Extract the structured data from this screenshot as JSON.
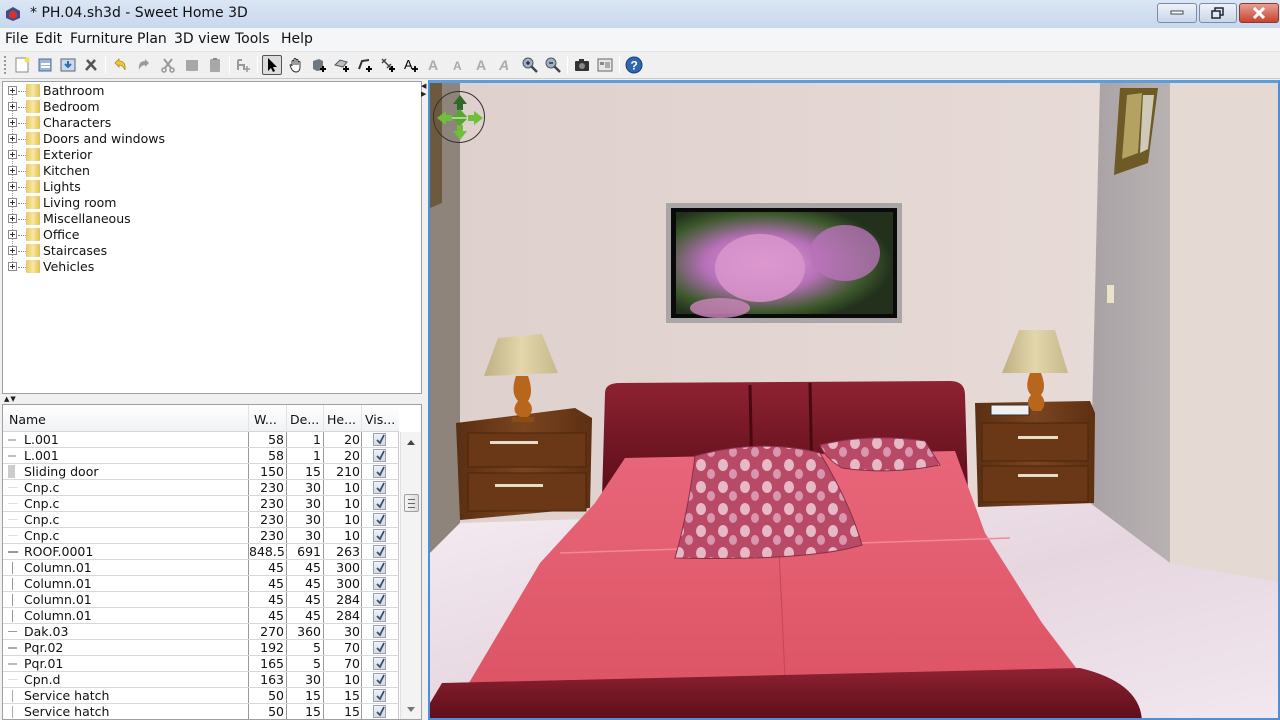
{
  "window": {
    "title": "* PH.04.sh3d - Sweet Home 3D",
    "controls": {
      "minimize": "minimize-icon",
      "maximize": "restore-icon",
      "close": "close-icon"
    }
  },
  "menu": {
    "items": [
      "File",
      "Edit",
      "Furniture",
      "Plan",
      "3D view",
      "Tools",
      "Help"
    ]
  },
  "toolbar": {
    "buttons": [
      {
        "name": "new-home",
        "icon": "new-file-icon",
        "enabled": true
      },
      {
        "name": "open",
        "icon": "open-folder-icon",
        "enabled": true
      },
      {
        "name": "save",
        "icon": "save-icon",
        "enabled": true
      },
      {
        "name": "preferences",
        "icon": "tools-icon",
        "enabled": true
      },
      {
        "name": "undo",
        "icon": "undo-icon",
        "enabled": true
      },
      {
        "name": "redo",
        "icon": "redo-icon",
        "enabled": false
      },
      {
        "name": "cut",
        "icon": "cut-icon",
        "enabled": false
      },
      {
        "name": "copy",
        "icon": "copy-icon",
        "enabled": false
      },
      {
        "name": "paste",
        "icon": "paste-icon",
        "enabled": false
      },
      {
        "name": "add-furniture",
        "icon": "add-furniture-icon",
        "enabled": false
      },
      {
        "name": "select-mode",
        "icon": "arrow-cursor-icon",
        "enabled": true,
        "selected": true
      },
      {
        "name": "pan-mode",
        "icon": "hand-icon",
        "enabled": true
      },
      {
        "name": "create-walls",
        "icon": "create-walls-icon",
        "enabled": true
      },
      {
        "name": "create-rooms",
        "icon": "create-rooms-icon",
        "enabled": true
      },
      {
        "name": "create-polylines",
        "icon": "create-polylines-icon",
        "enabled": true
      },
      {
        "name": "create-dimensions",
        "icon": "create-dimensions-icon",
        "enabled": true
      },
      {
        "name": "add-text",
        "icon": "add-text-icon",
        "enabled": true
      },
      {
        "name": "increase-text-size",
        "icon": "increase-text-icon",
        "enabled": false
      },
      {
        "name": "decrease-text-size",
        "icon": "decrease-text-icon",
        "enabled": false
      },
      {
        "name": "bold-text",
        "icon": "bold-text-icon",
        "enabled": false
      },
      {
        "name": "italic-text",
        "icon": "italic-text-icon",
        "enabled": false
      },
      {
        "name": "zoom-in",
        "icon": "zoom-in-icon",
        "enabled": true
      },
      {
        "name": "zoom-out",
        "icon": "zoom-out-icon",
        "enabled": true
      },
      {
        "name": "create-photo",
        "icon": "camera-icon",
        "enabled": true
      },
      {
        "name": "create-video",
        "icon": "video-icon",
        "enabled": true
      },
      {
        "name": "help",
        "icon": "help-icon",
        "enabled": true
      }
    ]
  },
  "catalog": {
    "categories": [
      "Bathroom",
      "Bedroom",
      "Characters",
      "Doors and windows",
      "Exterior",
      "Kitchen",
      "Lights",
      "Living room",
      "Miscellaneous",
      "Office",
      "Staircases",
      "Vehicles"
    ]
  },
  "furniture_table": {
    "columns": [
      "Name",
      "W...",
      "De...",
      "He...",
      "Vis..."
    ],
    "rows": [
      {
        "name": "L.001",
        "width": "58",
        "depth": "1",
        "height": "20",
        "visible": true
      },
      {
        "name": "L.001",
        "width": "58",
        "depth": "1",
        "height": "20",
        "visible": true
      },
      {
        "name": "Sliding door",
        "width": "150",
        "depth": "15",
        "height": "210",
        "visible": true
      },
      {
        "name": "Cnp.c",
        "width": "230",
        "depth": "30",
        "height": "10",
        "visible": true
      },
      {
        "name": "Cnp.c",
        "width": "230",
        "depth": "30",
        "height": "10",
        "visible": true
      },
      {
        "name": "Cnp.c",
        "width": "230",
        "depth": "30",
        "height": "10",
        "visible": true
      },
      {
        "name": "Cnp.c",
        "width": "230",
        "depth": "30",
        "height": "10",
        "visible": true
      },
      {
        "name": "ROOF.0001",
        "width": "848.5",
        "depth": "691",
        "height": "263",
        "visible": true
      },
      {
        "name": "Column.01",
        "width": "45",
        "depth": "45",
        "height": "300",
        "visible": true
      },
      {
        "name": "Column.01",
        "width": "45",
        "depth": "45",
        "height": "300",
        "visible": true
      },
      {
        "name": "Column.01",
        "width": "45",
        "depth": "45",
        "height": "284",
        "visible": true
      },
      {
        "name": "Column.01",
        "width": "45",
        "depth": "45",
        "height": "284",
        "visible": true
      },
      {
        "name": "Dak.03",
        "width": "270",
        "depth": "360",
        "height": "30",
        "visible": true
      },
      {
        "name": "Pqr.02",
        "width": "192",
        "depth": "5",
        "height": "70",
        "visible": true
      },
      {
        "name": "Pqr.01",
        "width": "165",
        "depth": "5",
        "height": "70",
        "visible": true
      },
      {
        "name": "Cpn.d",
        "width": "163",
        "depth": "30",
        "height": "10",
        "visible": true
      },
      {
        "name": "Service hatch",
        "width": "50",
        "depth": "15",
        "height": "15",
        "visible": true
      },
      {
        "name": "Service hatch",
        "width": "50",
        "depth": "15",
        "height": "15",
        "visible": true
      }
    ]
  },
  "view3d": {
    "scene": "bedroom-3d-render",
    "navigation": "navigation-arrows-icon",
    "colors": {
      "wall": "#e6d8d3",
      "side_wall": "#b5aeb0",
      "bed_sheet": "#e25a6a",
      "headboard": "#7a1424",
      "nightstand": "#6b3a18",
      "lamp_shade": "#d9cca0",
      "floor": "#eee4ec"
    }
  },
  "colors": {
    "accent": "#4a90d9",
    "close_button": "#c8432f"
  }
}
